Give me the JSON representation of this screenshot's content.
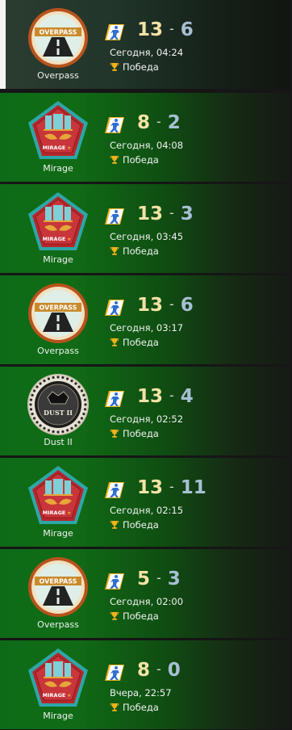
{
  "matches": [
    {
      "map": "Overpass",
      "map_icon": "overpass-icon",
      "score_team": "13",
      "score_opp": "6",
      "date": "Сегодня, 04:24",
      "result": "Победа",
      "selected": true
    },
    {
      "map": "Mirage",
      "map_icon": "mirage-icon",
      "score_team": "8",
      "score_opp": "2",
      "date": "Сегодня, 04:08",
      "result": "Победа",
      "selected": false
    },
    {
      "map": "Mirage",
      "map_icon": "mirage-icon",
      "score_team": "13",
      "score_opp": "3",
      "date": "Сегодня, 03:45",
      "result": "Победа",
      "selected": false
    },
    {
      "map": "Overpass",
      "map_icon": "overpass-icon",
      "score_team": "13",
      "score_opp": "6",
      "date": "Сегодня, 03:17",
      "result": "Победа",
      "selected": false
    },
    {
      "map": "Dust II",
      "map_icon": "dust2-icon",
      "score_team": "13",
      "score_opp": "4",
      "date": "Сегодня, 02:52",
      "result": "Победа",
      "selected": false
    },
    {
      "map": "Mirage",
      "map_icon": "mirage-icon",
      "score_team": "13",
      "score_opp": "11",
      "date": "Сегодня, 02:15",
      "result": "Победа",
      "selected": false
    },
    {
      "map": "Overpass",
      "map_icon": "overpass-icon",
      "score_team": "5",
      "score_opp": "3",
      "date": "Сегодня, 02:00",
      "result": "Победа",
      "selected": false
    },
    {
      "map": "Mirage",
      "map_icon": "mirage-icon",
      "score_team": "8",
      "score_opp": "0",
      "date": "Вчера, 22:57",
      "result": "Победа",
      "selected": false
    }
  ],
  "emblem_labels": {
    "overpass": "OVERPASS",
    "mirage": "MIRAGE",
    "dust2": "DUST II"
  },
  "side_icon": "counter-terrorist-icon",
  "trophy_icon": "trophy-icon",
  "colors": {
    "score_team": "#f5e2a6",
    "score_opp": "#a7c0d4",
    "side_icon_bg": "#f0b21a",
    "side_icon_fg": "#2f6fd1"
  }
}
